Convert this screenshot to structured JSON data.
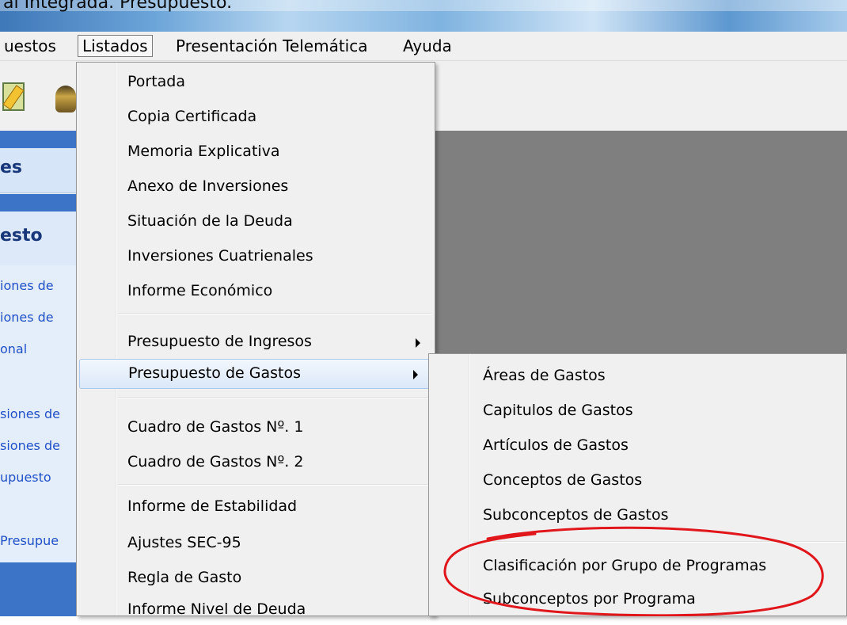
{
  "window": {
    "title": "al Integrada. Presupuesto."
  },
  "menubar": {
    "items": [
      {
        "label": "uestos"
      },
      {
        "label": "Listados"
      },
      {
        "label": "Presentación Telemática"
      },
      {
        "label": "Ayuda"
      }
    ]
  },
  "side_panel": {
    "header1": "es",
    "header2": "esto",
    "links": [
      "iones de",
      "iones de",
      "onal",
      "siones de",
      "siones de",
      "upuesto",
      "Presupue"
    ]
  },
  "listados_menu": {
    "items": [
      {
        "label": "Portada"
      },
      {
        "label": "Copia Certificada"
      },
      {
        "label": "Memoria Explicativa"
      },
      {
        "label": "Anexo de Inversiones"
      },
      {
        "label": "Situación de la Deuda"
      },
      {
        "label": "Inversiones Cuatrienales"
      },
      {
        "label": "Informe Económico"
      },
      {
        "label": "Presupuesto de Ingresos"
      },
      {
        "label": "Presupuesto de Gastos"
      },
      {
        "label": "Cuadro de Gastos Nº. 1"
      },
      {
        "label": "Cuadro de Gastos Nº. 2"
      },
      {
        "label": "Informe de Estabilidad"
      },
      {
        "label": "Ajustes SEC-95"
      },
      {
        "label": "Regla de Gasto"
      },
      {
        "label": "Informe Nivel de Deuda"
      }
    ]
  },
  "gastos_submenu": {
    "items": [
      {
        "label": "Áreas de Gastos"
      },
      {
        "label": "Capitulos de Gastos"
      },
      {
        "label": "Artículos de Gastos"
      },
      {
        "label": "Conceptos de Gastos"
      },
      {
        "label": "Subconceptos de Gastos"
      },
      {
        "label": "Clasificación por Grupo de Programas"
      },
      {
        "label": "Subconceptos por Programa"
      }
    ]
  },
  "colors": {
    "menu_background": "#f0f0f0",
    "menu_hover": "#dbe8f8",
    "side_panel_blue": "#3c74c8",
    "annotation_red": "#e0161b"
  },
  "icons": [
    "edit-icon",
    "toolbar-icon",
    "submenu-arrow-icon"
  ]
}
